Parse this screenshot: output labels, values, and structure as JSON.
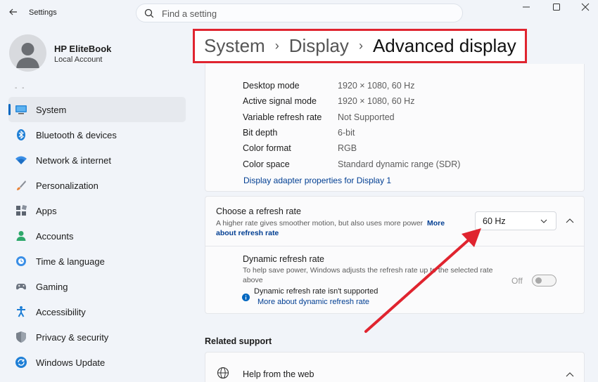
{
  "window": {
    "title": "Settings",
    "search_placeholder": "Find a setting"
  },
  "profile": {
    "name": "HP EliteBook",
    "account_type": "Local Account"
  },
  "sidebar": {
    "items": [
      {
        "label": "System",
        "icon": "monitor-icon",
        "active": true
      },
      {
        "label": "Bluetooth & devices",
        "icon": "bluetooth-icon"
      },
      {
        "label": "Network & internet",
        "icon": "wifi-icon"
      },
      {
        "label": "Personalization",
        "icon": "brush-icon"
      },
      {
        "label": "Apps",
        "icon": "apps-icon"
      },
      {
        "label": "Accounts",
        "icon": "person-icon"
      },
      {
        "label": "Time & language",
        "icon": "globe-clock-icon"
      },
      {
        "label": "Gaming",
        "icon": "gamepad-icon"
      },
      {
        "label": "Accessibility",
        "icon": "accessibility-icon"
      },
      {
        "label": "Privacy & security",
        "icon": "shield-icon"
      },
      {
        "label": "Windows Update",
        "icon": "update-icon"
      }
    ]
  },
  "breadcrumb": {
    "items": [
      "System",
      "Display"
    ],
    "current": "Advanced display",
    "separator": "›",
    "highlight_color": "#e0242f"
  },
  "display_info": {
    "rows": [
      {
        "key": "Desktop mode",
        "value": "1920 × 1080, 60 Hz"
      },
      {
        "key": "Active signal mode",
        "value": "1920 × 1080, 60 Hz"
      },
      {
        "key": "Variable refresh rate",
        "value": "Not Supported"
      },
      {
        "key": "Bit depth",
        "value": "6-bit"
      },
      {
        "key": "Color format",
        "value": "RGB"
      },
      {
        "key": "Color space",
        "value": "Standard dynamic range (SDR)"
      }
    ],
    "adapter_link": "Display adapter properties for Display 1"
  },
  "refresh_rate": {
    "title": "Choose a refresh rate",
    "description": "A higher rate gives smoother motion, but also uses more power",
    "more_link": "More",
    "more_link_2": "about refresh rate",
    "selected": "60 Hz"
  },
  "dynamic_refresh": {
    "title": "Dynamic refresh rate",
    "description": "To help save power, Windows adjusts the refresh rate up to the selected rate above",
    "toggle_label": "Off",
    "toggle_state": "off",
    "note": "Dynamic refresh rate isn't supported",
    "link": "More about dynamic refresh rate"
  },
  "related": {
    "header": "Related support",
    "help_label": "Help from the web"
  },
  "colors": {
    "accent": "#0067c0",
    "link": "#003e92",
    "annotation_red": "#e0242f"
  }
}
